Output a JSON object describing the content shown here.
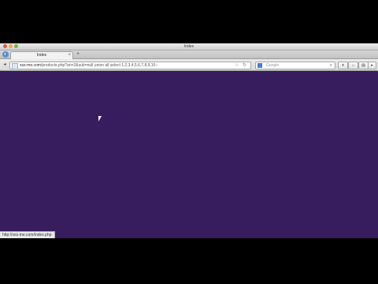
{
  "window": {
    "title": "Index"
  },
  "tabs": [
    {
      "label": "Index"
    }
  ],
  "navbar": {
    "url_host": "xss-me.com",
    "url_path": "/products.php?an=2&sub=null union all select 1,2,3,4,5,6,7,8,9,10--",
    "search_placeholder": "Google"
  },
  "status": {
    "text": "http://xss-me.com/index.php"
  },
  "colors": {
    "page_background": "#371c5e"
  }
}
